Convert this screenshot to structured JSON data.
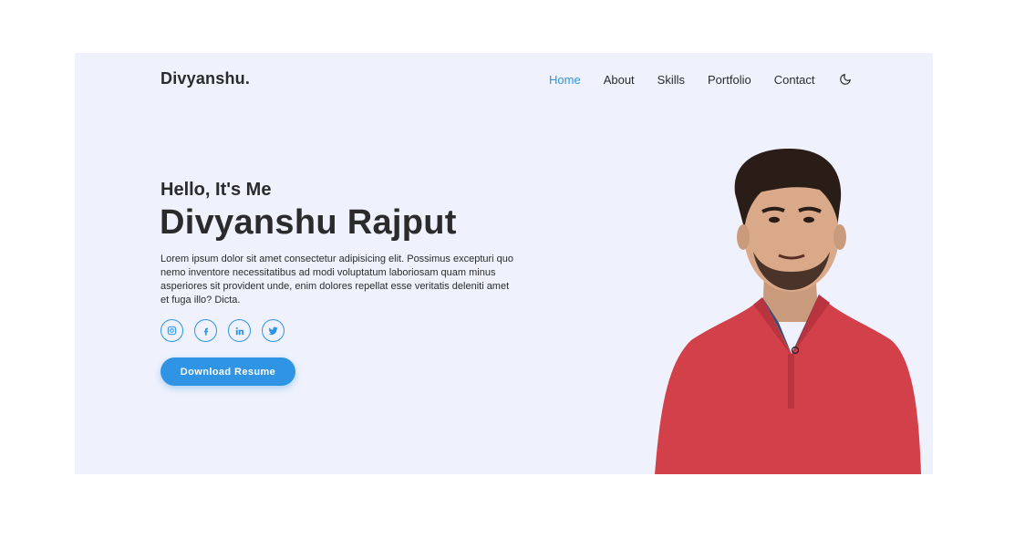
{
  "header": {
    "logo": "Divyanshu.",
    "nav": [
      {
        "label": "Home",
        "active": true
      },
      {
        "label": "About",
        "active": false
      },
      {
        "label": "Skills",
        "active": false
      },
      {
        "label": "Portfolio",
        "active": false
      },
      {
        "label": "Contact",
        "active": false
      }
    ],
    "theme_toggle_icon": "moon-icon"
  },
  "hero": {
    "greeting": "Hello, It's Me",
    "name": "Divyanshu Rajput",
    "bio": "Lorem ipsum dolor sit amet consectetur adipisicing elit. Possimus excepturi quo nemo inventore necessitatibus ad modi voluptatum laboriosam quam minus asperiores sit provident unde, enim dolores repellat esse veritatis deleniti amet et fuga illo? Dicta.",
    "socials": [
      "instagram-icon",
      "facebook-icon",
      "linkedin-icon",
      "twitter-icon"
    ],
    "button_label": "Download Resume",
    "portrait": "profile-photo"
  },
  "colors": {
    "accent": "#2f94e3",
    "background": "#eff2fc",
    "text": "#2b2b2b",
    "shirt": "#d2404a"
  }
}
